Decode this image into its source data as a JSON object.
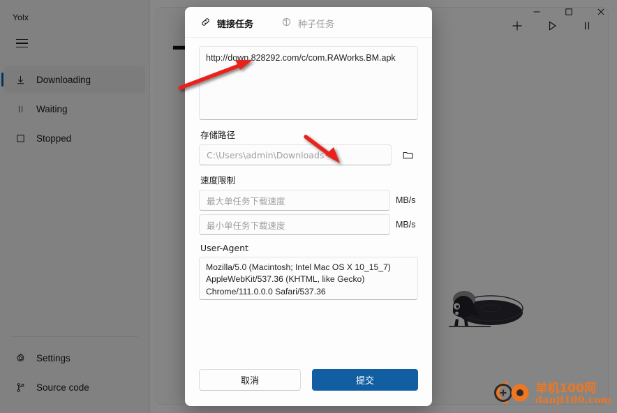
{
  "window": {
    "app_title": "Yolx",
    "controls": [
      {
        "name": "minimize",
        "glyph": "minimize-icon"
      },
      {
        "name": "maximize",
        "glyph": "maximize-icon"
      },
      {
        "name": "close",
        "glyph": "close-icon"
      }
    ]
  },
  "sidebar": {
    "menu_icon": "hamburger-icon",
    "items": [
      {
        "label": "Downloading",
        "icon": "download-arrow-icon",
        "active": true
      },
      {
        "label": "Waiting",
        "icon": "pause-icon",
        "active": false
      },
      {
        "label": "Stopped",
        "icon": "stop-square-icon",
        "active": false
      }
    ],
    "bottom_items": [
      {
        "label": "Settings",
        "icon": "gear-icon"
      },
      {
        "label": "Source code",
        "icon": "git-branch-icon"
      }
    ]
  },
  "toolbar": {
    "buttons": [
      {
        "name": "add-task",
        "icon": "plus-icon"
      },
      {
        "name": "start-all",
        "icon": "play-icon"
      },
      {
        "name": "pause-all",
        "icon": "pause-icon"
      }
    ]
  },
  "main": {
    "empty_state_char": "下"
  },
  "dialog": {
    "tabs": [
      {
        "label": "链接任务",
        "icon": "link-icon",
        "active": true
      },
      {
        "label": "种子任务",
        "icon": "magnet-seed-icon",
        "active": false
      }
    ],
    "url": {
      "value": "http://down.828292.com/c/com.RAWorks.BM.apk",
      "placeholder": ""
    },
    "storage_path": {
      "label": "存储路径",
      "placeholder": "C:\\Users\\admin\\Downloads",
      "value": "",
      "browse_icon": "folder-icon"
    },
    "speed_limit": {
      "label": "速度限制",
      "max": {
        "placeholder": "最大单任务下载速度",
        "value": "",
        "unit": "MB/s"
      },
      "min": {
        "placeholder": "最小单任务下载速度",
        "value": "",
        "unit": "MB/s"
      }
    },
    "user_agent": {
      "label": "User-Agent",
      "value": "Mozilla/5.0 (Macintosh; Intel Mac OS X 10_15_7) AppleWebKit/537.36 (KHTML, like Gecko) Chrome/111.0.0.0 Safari/537.36"
    },
    "footer": {
      "cancel_label": "取消",
      "submit_label": "提交",
      "submit_color": "#115ea3"
    }
  },
  "annotations": {
    "arrow_color": "#e8201a",
    "arrows": [
      {
        "name": "arrow-to-url",
        "points_to": "url-input"
      },
      {
        "name": "arrow-to-storage-path",
        "points_to": "storage-path-input"
      }
    ]
  },
  "watermark": {
    "cn": "单机100网",
    "en": "danji100.com",
    "color": "#ef7722"
  }
}
